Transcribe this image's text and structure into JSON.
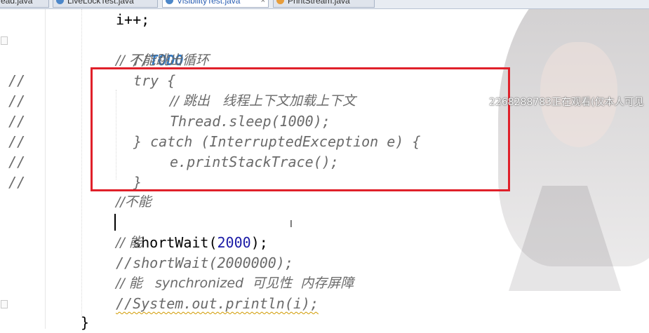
{
  "tabs": [
    {
      "label": "ead.java",
      "active": false
    },
    {
      "label": "LiveLockTest.java",
      "active": false
    },
    {
      "label": "VisibilityTest.java",
      "active": true
    },
    {
      "label": "PrintStream.java",
      "active": false
    }
  ],
  "gutter_comments": [
    "//",
    "//",
    "//",
    "//",
    "//",
    "//"
  ],
  "code": {
    "l1": "i++;",
    "l2_slashes": "//",
    "l2_todo": "TODO",
    "l3": "// 不能跳出循环",
    "l4": "try {",
    "l5": "// 跳出   线程上下文加载上下文",
    "l6": "Thread.sleep(1000);",
    "l7": "} catch (InterruptedException e) {",
    "l8": "e.printStackTrace();",
    "l9": "}",
    "l10": "//不能",
    "l11_name": "shortWait(",
    "l11_num": "2000",
    "l11_end": ");",
    "l12": "// 能",
    "l13": "//shortWait(2000000);",
    "l14": "// 能   synchronized  可见性  内存屏障",
    "l15": "//System.out.println(i);",
    "l16": "}"
  },
  "watermark": "2268288783正在观看(仅本人可见",
  "colors": {
    "highlight_box": "#e0202a",
    "todo": "#2f78c4",
    "number": "#1a1aa6",
    "comment": "#6a6a6a"
  }
}
